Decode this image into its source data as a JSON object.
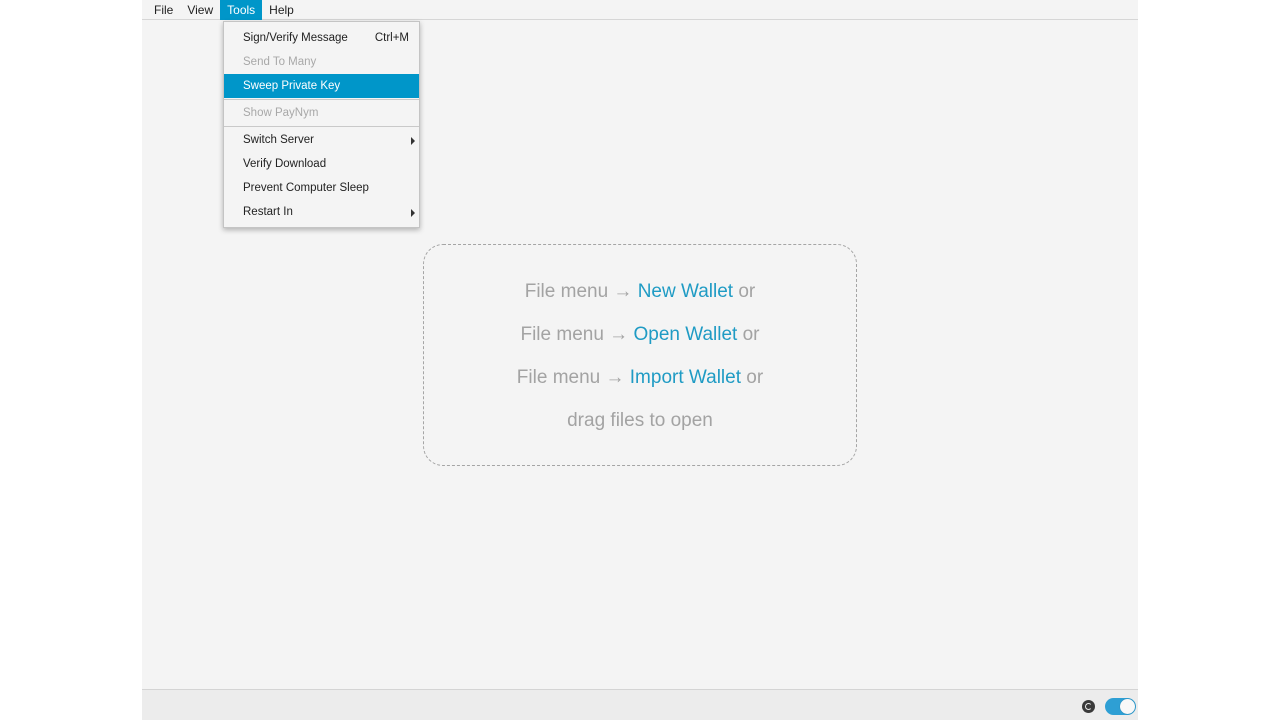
{
  "menubar": {
    "items": [
      {
        "label": "File"
      },
      {
        "label": "View"
      },
      {
        "label": "Tools",
        "active": true
      },
      {
        "label": "Help"
      }
    ]
  },
  "tools_menu": {
    "items": [
      {
        "label": "Sign/Verify Message",
        "accelerator": "Ctrl+M",
        "enabled": true
      },
      {
        "label": "Send To Many",
        "enabled": false
      },
      {
        "label": "Sweep Private Key",
        "enabled": true,
        "selected": true
      },
      {
        "label": "Show PayNym",
        "enabled": false
      },
      {
        "label": "Switch Server",
        "enabled": true,
        "submenu": true
      },
      {
        "label": "Verify Download",
        "enabled": true
      },
      {
        "label": "Prevent Computer Sleep",
        "enabled": true
      },
      {
        "label": "Restart In",
        "enabled": true,
        "submenu": true
      }
    ]
  },
  "drop_zone": {
    "prefix": "File menu → ",
    "suffix": " or",
    "link1": "New Wallet",
    "link2": "Open Wallet",
    "link3": "Import Wallet",
    "drag_text": "drag files to open"
  },
  "statusbar": {
    "tor_icon": "tor-onion-icon",
    "toggle_on": true
  },
  "colors": {
    "accent": "#0096c9",
    "link": "#1f9bc4",
    "background": "#f4f4f4",
    "muted_text": "#a3a3a3"
  }
}
